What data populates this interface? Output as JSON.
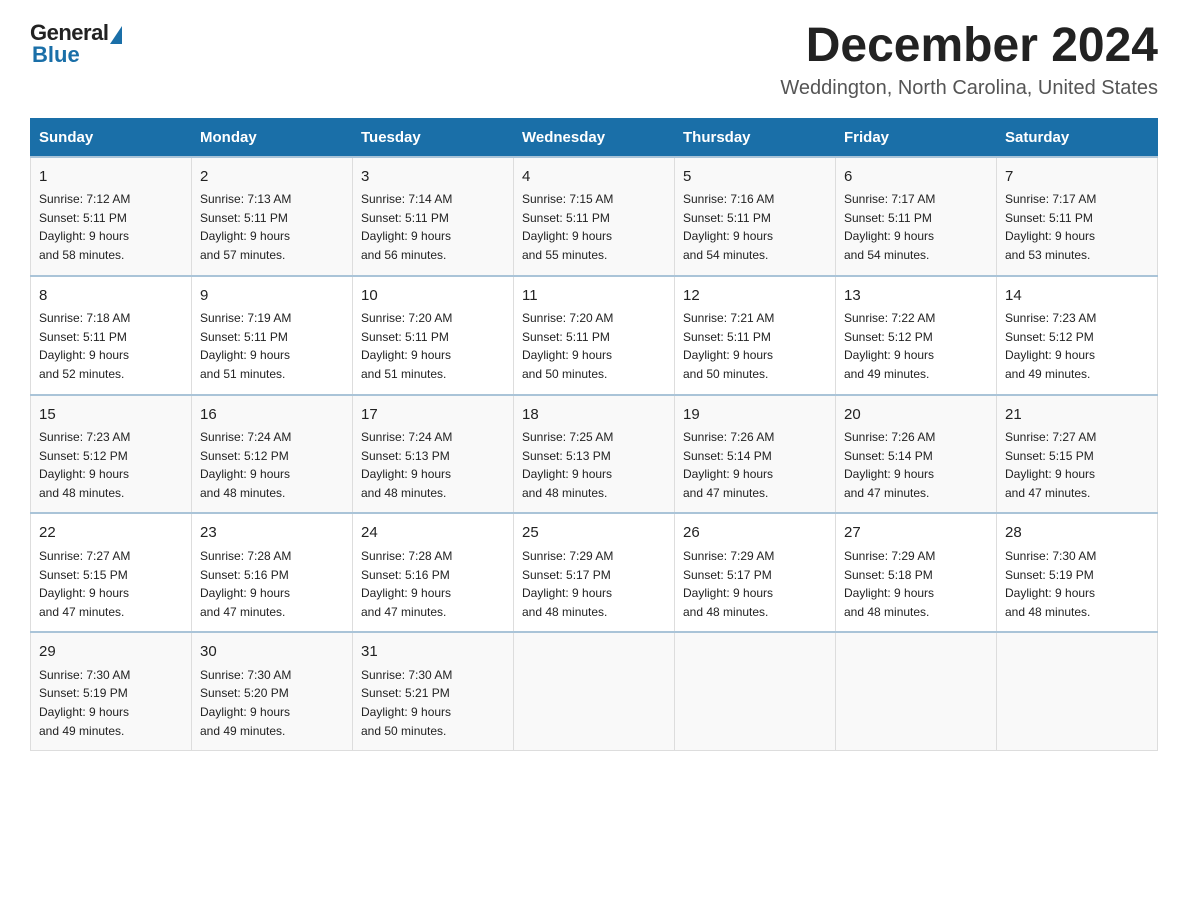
{
  "header": {
    "logo_general": "General",
    "logo_blue": "Blue",
    "month_title": "December 2024",
    "location": "Weddington, North Carolina, United States"
  },
  "weekdays": [
    "Sunday",
    "Monday",
    "Tuesday",
    "Wednesday",
    "Thursday",
    "Friday",
    "Saturday"
  ],
  "weeks": [
    [
      {
        "day": "1",
        "sunrise": "7:12 AM",
        "sunset": "5:11 PM",
        "daylight": "9 hours and 58 minutes."
      },
      {
        "day": "2",
        "sunrise": "7:13 AM",
        "sunset": "5:11 PM",
        "daylight": "9 hours and 57 minutes."
      },
      {
        "day": "3",
        "sunrise": "7:14 AM",
        "sunset": "5:11 PM",
        "daylight": "9 hours and 56 minutes."
      },
      {
        "day": "4",
        "sunrise": "7:15 AM",
        "sunset": "5:11 PM",
        "daylight": "9 hours and 55 minutes."
      },
      {
        "day": "5",
        "sunrise": "7:16 AM",
        "sunset": "5:11 PM",
        "daylight": "9 hours and 54 minutes."
      },
      {
        "day": "6",
        "sunrise": "7:17 AM",
        "sunset": "5:11 PM",
        "daylight": "9 hours and 54 minutes."
      },
      {
        "day": "7",
        "sunrise": "7:17 AM",
        "sunset": "5:11 PM",
        "daylight": "9 hours and 53 minutes."
      }
    ],
    [
      {
        "day": "8",
        "sunrise": "7:18 AM",
        "sunset": "5:11 PM",
        "daylight": "9 hours and 52 minutes."
      },
      {
        "day": "9",
        "sunrise": "7:19 AM",
        "sunset": "5:11 PM",
        "daylight": "9 hours and 51 minutes."
      },
      {
        "day": "10",
        "sunrise": "7:20 AM",
        "sunset": "5:11 PM",
        "daylight": "9 hours and 51 minutes."
      },
      {
        "day": "11",
        "sunrise": "7:20 AM",
        "sunset": "5:11 PM",
        "daylight": "9 hours and 50 minutes."
      },
      {
        "day": "12",
        "sunrise": "7:21 AM",
        "sunset": "5:11 PM",
        "daylight": "9 hours and 50 minutes."
      },
      {
        "day": "13",
        "sunrise": "7:22 AM",
        "sunset": "5:12 PM",
        "daylight": "9 hours and 49 minutes."
      },
      {
        "day": "14",
        "sunrise": "7:23 AM",
        "sunset": "5:12 PM",
        "daylight": "9 hours and 49 minutes."
      }
    ],
    [
      {
        "day": "15",
        "sunrise": "7:23 AM",
        "sunset": "5:12 PM",
        "daylight": "9 hours and 48 minutes."
      },
      {
        "day": "16",
        "sunrise": "7:24 AM",
        "sunset": "5:12 PM",
        "daylight": "9 hours and 48 minutes."
      },
      {
        "day": "17",
        "sunrise": "7:24 AM",
        "sunset": "5:13 PM",
        "daylight": "9 hours and 48 minutes."
      },
      {
        "day": "18",
        "sunrise": "7:25 AM",
        "sunset": "5:13 PM",
        "daylight": "9 hours and 48 minutes."
      },
      {
        "day": "19",
        "sunrise": "7:26 AM",
        "sunset": "5:14 PM",
        "daylight": "9 hours and 47 minutes."
      },
      {
        "day": "20",
        "sunrise": "7:26 AM",
        "sunset": "5:14 PM",
        "daylight": "9 hours and 47 minutes."
      },
      {
        "day": "21",
        "sunrise": "7:27 AM",
        "sunset": "5:15 PM",
        "daylight": "9 hours and 47 minutes."
      }
    ],
    [
      {
        "day": "22",
        "sunrise": "7:27 AM",
        "sunset": "5:15 PM",
        "daylight": "9 hours and 47 minutes."
      },
      {
        "day": "23",
        "sunrise": "7:28 AM",
        "sunset": "5:16 PM",
        "daylight": "9 hours and 47 minutes."
      },
      {
        "day": "24",
        "sunrise": "7:28 AM",
        "sunset": "5:16 PM",
        "daylight": "9 hours and 47 minutes."
      },
      {
        "day": "25",
        "sunrise": "7:29 AM",
        "sunset": "5:17 PM",
        "daylight": "9 hours and 48 minutes."
      },
      {
        "day": "26",
        "sunrise": "7:29 AM",
        "sunset": "5:17 PM",
        "daylight": "9 hours and 48 minutes."
      },
      {
        "day": "27",
        "sunrise": "7:29 AM",
        "sunset": "5:18 PM",
        "daylight": "9 hours and 48 minutes."
      },
      {
        "day": "28",
        "sunrise": "7:30 AM",
        "sunset": "5:19 PM",
        "daylight": "9 hours and 48 minutes."
      }
    ],
    [
      {
        "day": "29",
        "sunrise": "7:30 AM",
        "sunset": "5:19 PM",
        "daylight": "9 hours and 49 minutes."
      },
      {
        "day": "30",
        "sunrise": "7:30 AM",
        "sunset": "5:20 PM",
        "daylight": "9 hours and 49 minutes."
      },
      {
        "day": "31",
        "sunrise": "7:30 AM",
        "sunset": "5:21 PM",
        "daylight": "9 hours and 50 minutes."
      },
      null,
      null,
      null,
      null
    ]
  ],
  "labels": {
    "sunrise_prefix": "Sunrise: ",
    "sunset_prefix": "Sunset: ",
    "daylight_prefix": "Daylight: "
  }
}
